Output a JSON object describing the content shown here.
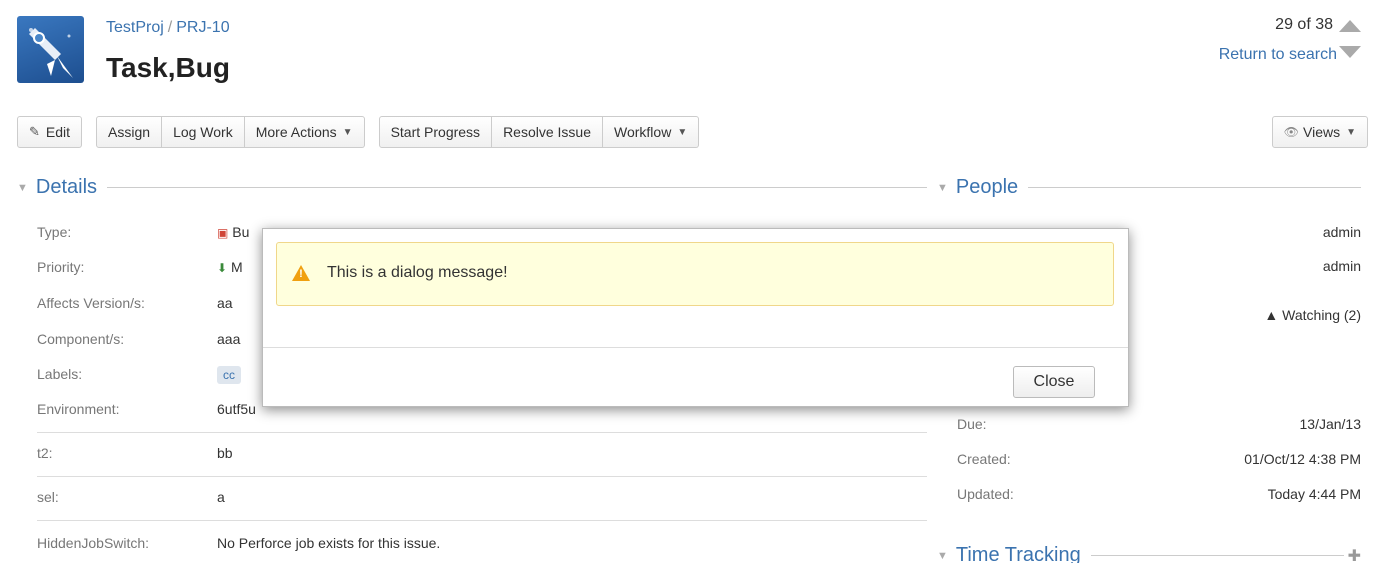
{
  "header": {
    "project": "TestProj",
    "separator": "/",
    "issue_key": "PRJ-10",
    "title": "Task,Bug",
    "pager": "29 of 38",
    "return_link": "Return to search"
  },
  "toolbar": {
    "edit": "Edit",
    "assign": "Assign",
    "log_work": "Log Work",
    "more_actions": "More Actions",
    "start_progress": "Start Progress",
    "resolve_issue": "Resolve Issue",
    "workflow": "Workflow",
    "views": "Views"
  },
  "details": {
    "title": "Details",
    "fields": [
      {
        "label": "Type:",
        "value": "Bu"
      },
      {
        "label": "Priority:",
        "value": "M"
      },
      {
        "label": "Affects Version/s:",
        "value": "aa"
      },
      {
        "label": "Component/s:",
        "value": "aaa"
      },
      {
        "label": "Labels:",
        "value": "cc"
      },
      {
        "label": "Environment:",
        "value": "6utf5u"
      },
      {
        "label": "t2:",
        "value": "bb"
      },
      {
        "label": "sel:",
        "value": "a"
      },
      {
        "label": "HiddenJobSwitch:",
        "value": "No Perforce job exists for this issue."
      }
    ]
  },
  "people": {
    "title": "People",
    "assignee": "admin",
    "reporter": "admin",
    "watching": "Watching (2)"
  },
  "dates": {
    "due_label": "Due:",
    "due": "13/Jan/13",
    "created_label": "Created:",
    "created": "01/Oct/12 4:38 PM",
    "updated_label": "Updated:",
    "updated": "Today 4:44 PM"
  },
  "time_tracking": {
    "title": "Time Tracking"
  },
  "dialog": {
    "message": "This is a dialog message!",
    "close": "Close"
  },
  "colors": {
    "link": "#3b73af",
    "warning": "#f0a010",
    "message_bg": "#ffffdd"
  }
}
